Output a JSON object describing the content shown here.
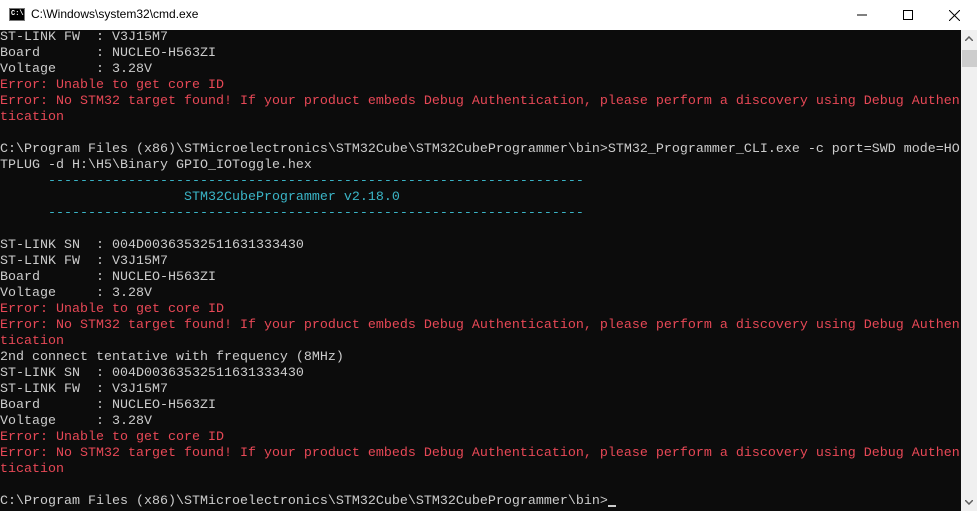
{
  "window": {
    "title": "C:\\Windows\\system32\\cmd.exe",
    "icon_text": "C:\\"
  },
  "console": {
    "lines": [
      {
        "text": "ST-LINK FW  : V3J15M7"
      },
      {
        "text": "Board       : NUCLEO-H563ZI"
      },
      {
        "text": "Voltage     : 3.28V"
      },
      {
        "text": "Error: Unable to get core ID"
      },
      {
        "text": "Error: No STM32 target found! If your product embeds Debug Authentication, please perform a discovery using Debug Authen"
      },
      {
        "text": "tication"
      },
      {
        "text": ""
      },
      {
        "text": "C:\\Program Files (x86)\\STMicroelectronics\\STM32Cube\\STM32CubeProgrammer\\bin>STM32_Programmer_CLI.exe -c port=SWD mode=HO"
      },
      {
        "text": "TPLUG -d H:\\H5\\Binary GPIO_IOToggle.hex"
      },
      {
        "text": "      -------------------------------------------------------------------"
      },
      {
        "text": "                       STM32CubeProgrammer v2.18.0"
      },
      {
        "text": "      -------------------------------------------------------------------"
      },
      {
        "text": ""
      },
      {
        "text": "ST-LINK SN  : 004D00363532511631333430"
      },
      {
        "text": "ST-LINK FW  : V3J15M7"
      },
      {
        "text": "Board       : NUCLEO-H563ZI"
      },
      {
        "text": "Voltage     : 3.28V"
      },
      {
        "text": "Error: Unable to get core ID"
      },
      {
        "text": "Error: No STM32 target found! If your product embeds Debug Authentication, please perform a discovery using Debug Authen"
      },
      {
        "text": "tication"
      },
      {
        "text": "2nd connect tentative with frequency (8MHz)"
      },
      {
        "text": "ST-LINK SN  : 004D00363532511631333430"
      },
      {
        "text": "ST-LINK FW  : V3J15M7"
      },
      {
        "text": "Board       : NUCLEO-H563ZI"
      },
      {
        "text": "Voltage     : 3.28V"
      },
      {
        "text": "Error: Unable to get core ID"
      },
      {
        "text": "Error: No STM32 target found! If your product embeds Debug Authentication, please perform a discovery using Debug Authen"
      },
      {
        "text": "tication"
      },
      {
        "text": ""
      },
      {
        "text": "C:\\Program Files (x86)\\STMicroelectronics\\STM32Cube\\STM32CubeProgrammer\\bin>"
      }
    ]
  },
  "colors": {
    "background": "#0c0c0c",
    "text": "#cccccc",
    "error": "#e74856",
    "banner": "#3ab4c6"
  }
}
